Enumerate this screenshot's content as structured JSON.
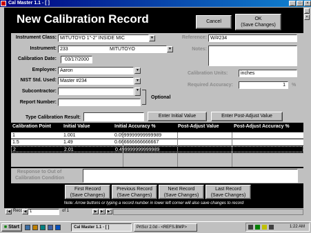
{
  "window": {
    "title": "Cal Master 1.1 - [ ]"
  },
  "header": {
    "title": "New Calibration Record",
    "cancel_label": "Cancel",
    "ok_label": "OK",
    "ok_sub_label": "(Save Changes)"
  },
  "form": {
    "instrument_class_label": "Instrument Class:",
    "instrument_class_value": "MITUTOYO 1\"-2\" INSIDE MIC",
    "instrument_label": "Instrument:",
    "instrument_id": "233",
    "instrument_maker": "MITUTOYO",
    "calibration_date_label": "Calibration Date:",
    "calibration_date_value": "03/17/2000",
    "employee_label": "Employee:",
    "employee_value": "Aaron",
    "nist_label": "NIST Std. Used:",
    "nist_value": "Master #234",
    "subcontractor_label": "Subcontractor:",
    "subcontractor_value": "",
    "report_number_label": "Report Number:",
    "report_number_value": "",
    "optional_label": "Optional",
    "reference_label": "Reference:",
    "reference_value": "W/#234",
    "notes_label": "Notes:",
    "notes_value": "",
    "calibration_units_label": "Calibration Units:",
    "calibration_units_value": "inches",
    "required_accuracy_label": "Required Accuracy:",
    "required_accuracy_value": "1",
    "percent_sign": "%",
    "type_result_label": "Type Calibration Result:",
    "type_result_value": "",
    "enter_initial_label": "Enter Initial Value",
    "enter_post_adjust_label": "Enter Post-Adjust Value"
  },
  "grid": {
    "headers": [
      "Calibration Point",
      "Initial Value",
      "Initial Accuracy %",
      "Post-Adjust Value",
      "Post-Adjust Accuracy %"
    ],
    "rows": [
      {
        "point": "1",
        "initial": "1.001",
        "accuracy": "0.0999999999999989",
        "post": "",
        "post_acc": ""
      },
      {
        "point": "1.5",
        "initial": "1.49",
        "accuracy": "0.666666666666667",
        "post": "",
        "post_acc": ""
      },
      {
        "point": "2",
        "initial": "2.01",
        "accuracy": "0.499999999999989",
        "post": "",
        "post_acc": ""
      }
    ]
  },
  "response": {
    "label_line1": "Response to Out of",
    "label_line2": "Calibration Condition",
    "value": ""
  },
  "nav": {
    "first_label": "First Record",
    "previous_label": "Previous Record",
    "next_label": "Next Record",
    "last_label": "Last Record",
    "save_sub": "(Save Changes)",
    "note": "Note: Arrow buttons or typing a record number in lower left corner will also save changes to record"
  },
  "recnav": {
    "record_label": "Record:",
    "record_value": "1",
    "of_label": "of 1"
  },
  "taskbar": {
    "start_label": "Start",
    "tasks": [
      "Cal Master 1.1 - [ ]",
      "PrtScr 2.0d - <REFS.BMP>"
    ],
    "clock": "1:22 AM"
  },
  "colors": {
    "title_bar": "#000080",
    "background": "#c0c0c0",
    "form_black": "#000000"
  }
}
